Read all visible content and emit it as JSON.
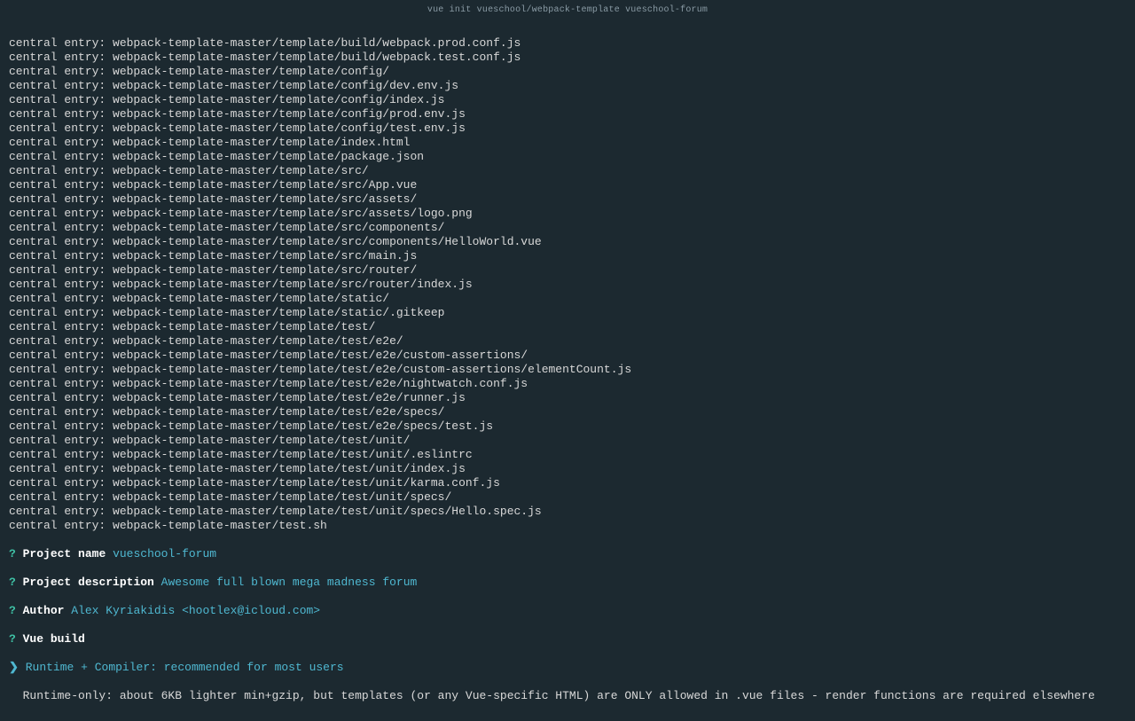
{
  "title": "vue init vueschool/webpack-template vueschool-forum",
  "log_prefix": "central entry: ",
  "log_paths": [
    "webpack-template-master/template/build/webpack.prod.conf.js",
    "webpack-template-master/template/build/webpack.test.conf.js",
    "webpack-template-master/template/config/",
    "webpack-template-master/template/config/dev.env.js",
    "webpack-template-master/template/config/index.js",
    "webpack-template-master/template/config/prod.env.js",
    "webpack-template-master/template/config/test.env.js",
    "webpack-template-master/template/index.html",
    "webpack-template-master/template/package.json",
    "webpack-template-master/template/src/",
    "webpack-template-master/template/src/App.vue",
    "webpack-template-master/template/src/assets/",
    "webpack-template-master/template/src/assets/logo.png",
    "webpack-template-master/template/src/components/",
    "webpack-template-master/template/src/components/HelloWorld.vue",
    "webpack-template-master/template/src/main.js",
    "webpack-template-master/template/src/router/",
    "webpack-template-master/template/src/router/index.js",
    "webpack-template-master/template/static/",
    "webpack-template-master/template/static/.gitkeep",
    "webpack-template-master/template/test/",
    "webpack-template-master/template/test/e2e/",
    "webpack-template-master/template/test/e2e/custom-assertions/",
    "webpack-template-master/template/test/e2e/custom-assertions/elementCount.js",
    "webpack-template-master/template/test/e2e/nightwatch.conf.js",
    "webpack-template-master/template/test/e2e/runner.js",
    "webpack-template-master/template/test/e2e/specs/",
    "webpack-template-master/template/test/e2e/specs/test.js",
    "webpack-template-master/template/test/unit/",
    "webpack-template-master/template/test/unit/.eslintrc",
    "webpack-template-master/template/test/unit/index.js",
    "webpack-template-master/template/test/unit/karma.conf.js",
    "webpack-template-master/template/test/unit/specs/",
    "webpack-template-master/template/test/unit/specs/Hello.spec.js",
    "webpack-template-master/test.sh"
  ],
  "prompts": {
    "q": "?",
    "arrow": "❯",
    "name_label": "Project name",
    "name_value": "vueschool-forum",
    "desc_label": "Project description",
    "desc_value": "Awesome full blown mega madness forum",
    "author_label": "Author",
    "author_value": "Alex Kyriakidis <hootlex@icloud.com>",
    "build_label": "Vue build",
    "option_selected": "Runtime + Compiler: recommended for most users",
    "option_other": "Runtime-only: about 6KB lighter min+gzip, but templates (or any Vue-specific HTML) are ONLY allowed in .vue files - render functions are required elsewhere"
  }
}
